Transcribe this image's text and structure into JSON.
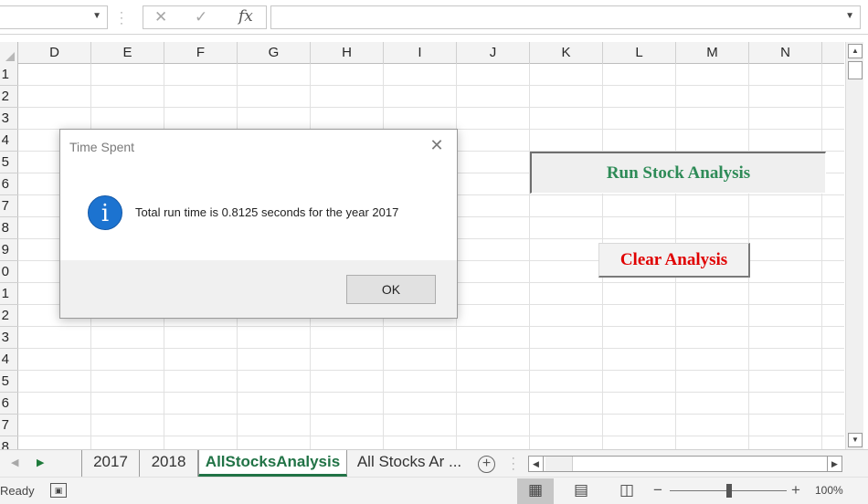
{
  "formula_bar": {
    "namebox_value": "",
    "cancel_icon": "✕",
    "enter_icon": "✓",
    "fx_label": "fx",
    "formula_value": ""
  },
  "columns": [
    "D",
    "E",
    "F",
    "G",
    "H",
    "I",
    "J",
    "K",
    "L",
    "M",
    "N"
  ],
  "rows": [
    "1",
    "2",
    "3",
    "4",
    "5",
    "6",
    "7",
    "8",
    "9",
    "0",
    "1",
    "2",
    "3",
    "4",
    "5",
    "6",
    "7",
    "8"
  ],
  "sheet_buttons": {
    "run_label": "Run Stock Analysis",
    "clear_label": "Clear Analysis",
    "run_color": "#2e8b57",
    "clear_color": "#e00000"
  },
  "dialog": {
    "title": "Time Spent",
    "icon": "info-icon",
    "message": "Total run time is 0.8125 seconds for the year 2017",
    "ok_label": "OK"
  },
  "tabs": [
    {
      "label": "2017",
      "active": false
    },
    {
      "label": "2018",
      "active": false
    },
    {
      "label": "AllStocksAnalysis",
      "active": true
    },
    {
      "label": "All Stocks Ar ...",
      "active": false
    }
  ],
  "status": {
    "ready": "Ready",
    "zoom": "100%"
  },
  "colors": {
    "accent": "#217346",
    "info": "#1c73d0"
  }
}
